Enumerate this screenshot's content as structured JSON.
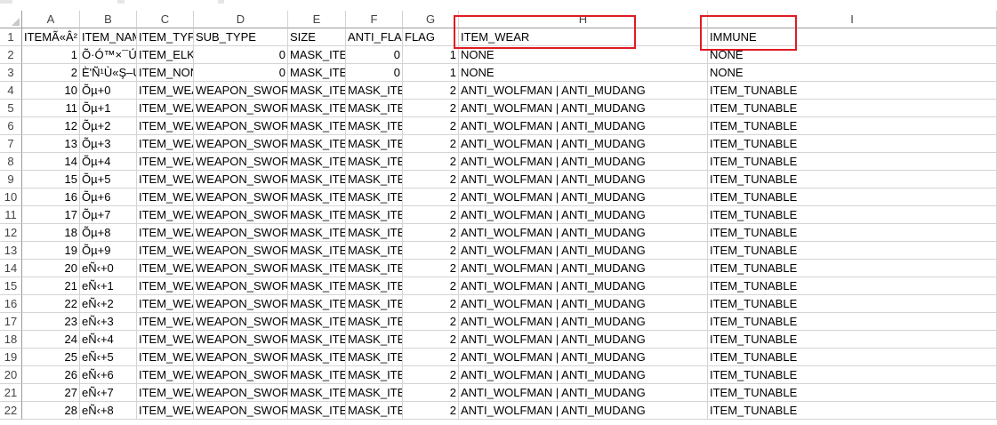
{
  "column_headers": [
    "A",
    "B",
    "C",
    "D",
    "E",
    "F",
    "G",
    "H",
    "I"
  ],
  "row_numbers": [
    "1",
    "2",
    "3",
    "4",
    "5",
    "6",
    "7",
    "8",
    "9",
    "10",
    "11",
    "12",
    "13",
    "14",
    "15",
    "16",
    "17",
    "18",
    "19",
    "20",
    "21",
    "22"
  ],
  "rows": [
    [
      "ITEMÃ«Â²",
      "ITEM_NAM",
      "ITEM_TYPI",
      "SUB_TYPE",
      "SIZE",
      "ANTI_FLAG",
      "FLAG",
      "ITEM_WEAR",
      "IMMUNE"
    ],
    [
      "1",
      "Õ·Ó™×¯ÚÓ",
      "ITEM_ELK",
      "0",
      "MASK_ITE",
      "0",
      "1",
      "NONE",
      "NONE"
    ],
    [
      "2",
      "È'Ñ¹Ù«Ş–Ú",
      "ITEM_NON",
      "0",
      "MASK_ITE",
      "0",
      "1",
      "NONE",
      "NONE"
    ],
    [
      "10",
      "Õµ+0",
      "ITEM_WEA",
      "WEAPON_SWORD",
      "MASK_ITE",
      "MASK_ITE",
      "2",
      "ANTI_WOLFMAN | ANTI_MUDANG",
      "ITEM_TUNABLE"
    ],
    [
      "11",
      "Õµ+1",
      "ITEM_WEA",
      "WEAPON_SWORD",
      "MASK_ITE",
      "MASK_ITE",
      "2",
      "ANTI_WOLFMAN | ANTI_MUDANG",
      "ITEM_TUNABLE"
    ],
    [
      "12",
      "Õµ+2",
      "ITEM_WEA",
      "WEAPON_SWORD",
      "MASK_ITE",
      "MASK_ITE",
      "2",
      "ANTI_WOLFMAN | ANTI_MUDANG",
      "ITEM_TUNABLE"
    ],
    [
      "13",
      "Õµ+3",
      "ITEM_WEA",
      "WEAPON_SWORD",
      "MASK_ITE",
      "MASK_ITE",
      "2",
      "ANTI_WOLFMAN | ANTI_MUDANG",
      "ITEM_TUNABLE"
    ],
    [
      "14",
      "Õµ+4",
      "ITEM_WEA",
      "WEAPON_SWORD",
      "MASK_ITE",
      "MASK_ITE",
      "2",
      "ANTI_WOLFMAN | ANTI_MUDANG",
      "ITEM_TUNABLE"
    ],
    [
      "15",
      "Õµ+5",
      "ITEM_WEA",
      "WEAPON_SWORD",
      "MASK_ITE",
      "MASK_ITE",
      "2",
      "ANTI_WOLFMAN | ANTI_MUDANG",
      "ITEM_TUNABLE"
    ],
    [
      "16",
      "Õµ+6",
      "ITEM_WEA",
      "WEAPON_SWORD",
      "MASK_ITE",
      "MASK_ITE",
      "2",
      "ANTI_WOLFMAN | ANTI_MUDANG",
      "ITEM_TUNABLE"
    ],
    [
      "17",
      "Õµ+7",
      "ITEM_WEA",
      "WEAPON_SWORD",
      "MASK_ITE",
      "MASK_ITE",
      "2",
      "ANTI_WOLFMAN | ANTI_MUDANG",
      "ITEM_TUNABLE"
    ],
    [
      "18",
      "Õµ+8",
      "ITEM_WEA",
      "WEAPON_SWORD",
      "MASK_ITE",
      "MASK_ITE",
      "2",
      "ANTI_WOLFMAN | ANTI_MUDANG",
      "ITEM_TUNABLE"
    ],
    [
      "19",
      "Õµ+9",
      "ITEM_WEA",
      "WEAPON_SWORD",
      "MASK_ITE",
      "MASK_ITE",
      "2",
      "ANTI_WOLFMAN | ANTI_MUDANG",
      "ITEM_TUNABLE"
    ],
    [
      "20",
      "eÑ‹+0",
      "ITEM_WEA",
      "WEAPON_SWORD",
      "MASK_ITE",
      "MASK_ITE",
      "2",
      "ANTI_WOLFMAN | ANTI_MUDANG",
      "ITEM_TUNABLE"
    ],
    [
      "21",
      "eÑ‹+1",
      "ITEM_WEA",
      "WEAPON_SWORD",
      "MASK_ITE",
      "MASK_ITE",
      "2",
      "ANTI_WOLFMAN | ANTI_MUDANG",
      "ITEM_TUNABLE"
    ],
    [
      "22",
      "eÑ‹+2",
      "ITEM_WEA",
      "WEAPON_SWORD",
      "MASK_ITE",
      "MASK_ITE",
      "2",
      "ANTI_WOLFMAN | ANTI_MUDANG",
      "ITEM_TUNABLE"
    ],
    [
      "23",
      "eÑ‹+3",
      "ITEM_WEA",
      "WEAPON_SWORD",
      "MASK_ITE",
      "MASK_ITE",
      "2",
      "ANTI_WOLFMAN | ANTI_MUDANG",
      "ITEM_TUNABLE"
    ],
    [
      "24",
      "eÑ‹+4",
      "ITEM_WEA",
      "WEAPON_SWORD",
      "MASK_ITE",
      "MASK_ITE",
      "2",
      "ANTI_WOLFMAN | ANTI_MUDANG",
      "ITEM_TUNABLE"
    ],
    [
      "25",
      "eÑ‹+5",
      "ITEM_WEA",
      "WEAPON_SWORD",
      "MASK_ITE",
      "MASK_ITE",
      "2",
      "ANTI_WOLFMAN | ANTI_MUDANG",
      "ITEM_TUNABLE"
    ],
    [
      "26",
      "eÑ‹+6",
      "ITEM_WEA",
      "WEAPON_SWORD",
      "MASK_ITE",
      "MASK_ITE",
      "2",
      "ANTI_WOLFMAN | ANTI_MUDANG",
      "ITEM_TUNABLE"
    ],
    [
      "27",
      "eÑ‹+7",
      "ITEM_WEA",
      "WEAPON_SWORD",
      "MASK_ITE",
      "MASK_ITE",
      "2",
      "ANTI_WOLFMAN | ANTI_MUDANG",
      "ITEM_TUNABLE"
    ],
    [
      "28",
      "eÑ‹+8",
      "ITEM_WEA",
      "WEAPON_SWORD",
      "MASK_ITE",
      "MASK_ITE",
      "2",
      "ANTI_WOLFMAN | ANTI_MUDANG",
      "ITEM_TUNABLE"
    ]
  ],
  "annotation_color": "#e01b24",
  "highlighted_columns": [
    "H",
    "I"
  ]
}
